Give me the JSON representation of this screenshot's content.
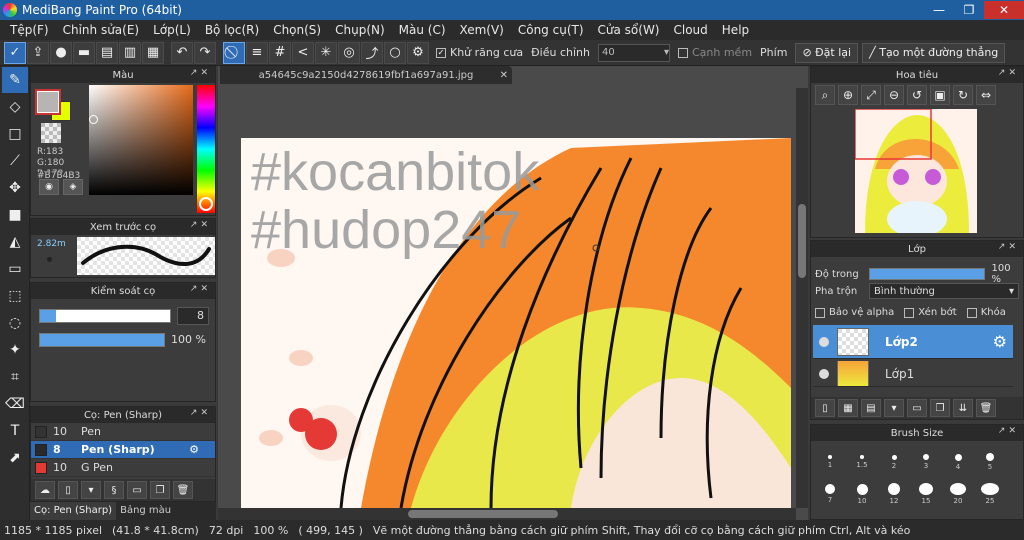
{
  "window": {
    "title": "MediBang Paint Pro (64bit)",
    "minimize": "—",
    "restore": "❐",
    "close": "✕"
  },
  "menu": [
    "Tệp(F)",
    "Chỉnh sửa(E)",
    "Lớp(L)",
    "Bộ lọc(R)",
    "Chọn(S)",
    "Chụp(N)",
    "Màu (C)",
    "Xem(V)",
    "Công cụ(T)",
    "Cửa sổ(W)",
    "Cloud",
    "Help"
  ],
  "toolbar": {
    "antialias_label": "Khử răng cưa",
    "adjust_label": "Điều chỉnh",
    "adjust_value": "40",
    "soft_edge_label": "Cạnh mềm",
    "key_label": "Phím",
    "reset_button": "Đặt lại",
    "straight_line_button": "Tạo một đường thẳng"
  },
  "color_panel": {
    "title": "Màu",
    "r": "R:183",
    "g": "G:180",
    "b": "B:179",
    "hex": "#B7B4B3",
    "colors": {
      "main": "#b7b4b3",
      "sub": "#e6ff00",
      "hue_base": "#e66a1a"
    }
  },
  "brush_preview": {
    "title": "Xem trước cọ",
    "size": "2.82m"
  },
  "brush_control": {
    "title": "Kiểm soát cọ",
    "size_value": "8",
    "opacity_value": "100 %",
    "size_fraction": 0.12,
    "opacity_fraction": 1.0
  },
  "brush_list": {
    "title": "Cọ: Pen (Sharp)",
    "items": [
      {
        "size": "10",
        "name": "Pen",
        "color": "#333333"
      },
      {
        "size": "8",
        "name": "Pen (Sharp)",
        "color": "#2a2a2a"
      },
      {
        "size": "10",
        "name": "G Pen",
        "color": "#e53935"
      }
    ]
  },
  "bottom_tabs": {
    "brush_tab": "Cọ: Pen (Sharp)",
    "palette_tab": "Bảng màu"
  },
  "document": {
    "tab_name": "a54645c9a2150d4278619fbf1a697a91.jpg"
  },
  "canvas_overlay": {
    "line1": "#kocanbitok",
    "line2": "#hudop247"
  },
  "navigator": {
    "title": "Hoa tiêu"
  },
  "layers": {
    "title": "Lớp",
    "opacity_label": "Độ trong",
    "opacity_value": "100 %",
    "opacity_fraction": 1.0,
    "blend_label": "Pha trộn",
    "blend_value": "Bình thường",
    "protect_alpha": "Bảo vệ alpha",
    "clip": "Xén bớt",
    "lock": "Khóa",
    "items": [
      {
        "name": "Lớp2"
      },
      {
        "name": "Lớp1"
      }
    ]
  },
  "brush_size": {
    "title": "Brush Size",
    "labels": [
      "1",
      "1.5",
      "2",
      "3",
      "4",
      "5",
      "7",
      "10",
      "12",
      "15",
      "20",
      "25"
    ]
  },
  "status": {
    "pixel_size": "1185 * 1185 pixel",
    "physical_size": "(41.8 * 41.8cm)",
    "dpi": "72 dpi",
    "zoom": "100 %",
    "coords": "( 499, 145 )",
    "hint": "Vẽ một đường thẳng bằng cách giữ phím Shift, Thay đổi cỡ cọ bằng cách giữ phím Ctrl, Alt và kéo"
  }
}
